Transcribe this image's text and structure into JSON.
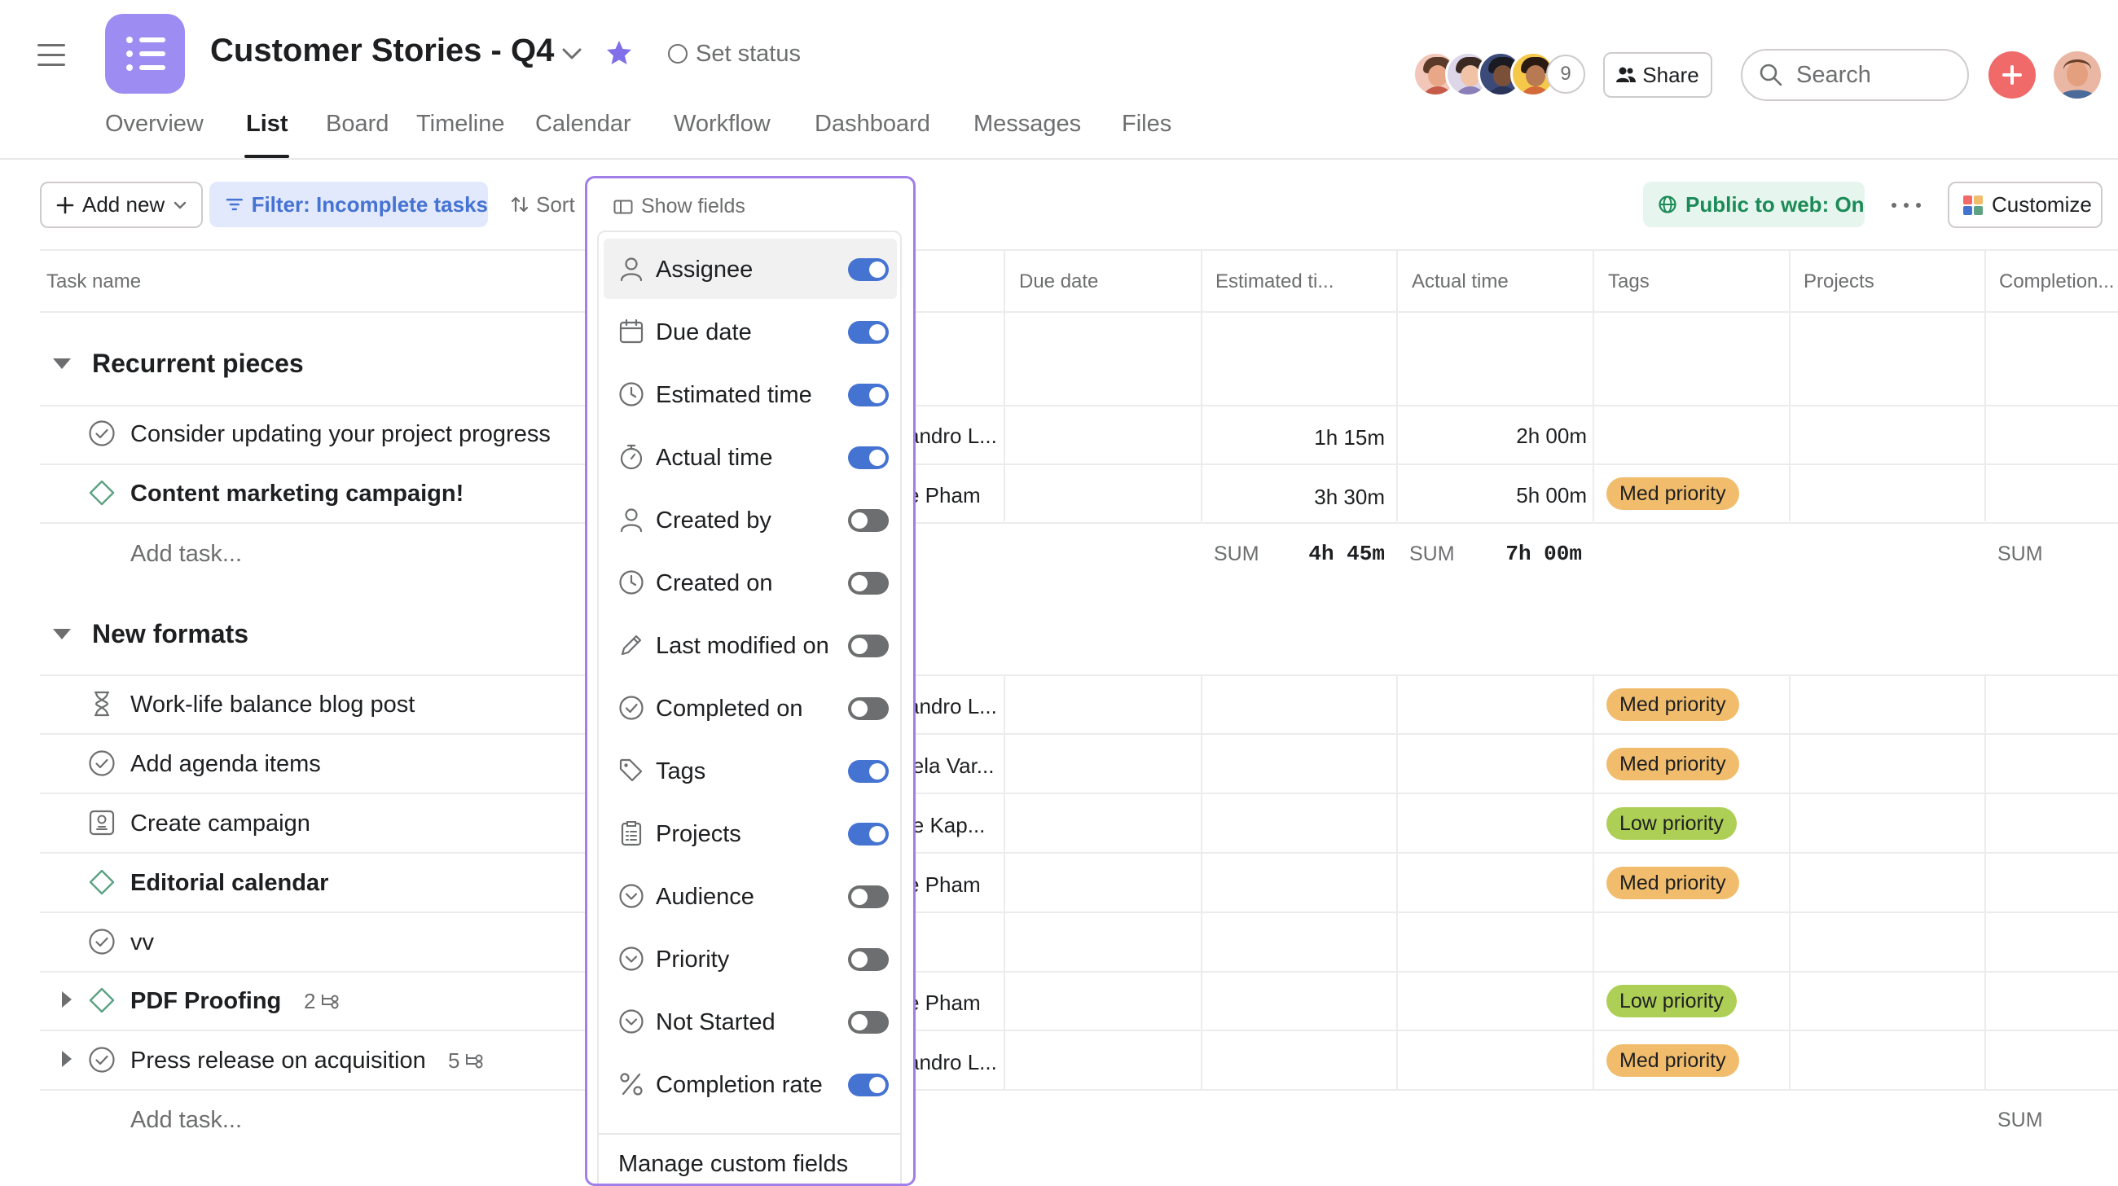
{
  "header": {
    "project_title": "Customer Stories - Q4",
    "set_status": "Set status",
    "avatar_overflow_count": "9",
    "share_label": "Share",
    "search_placeholder": "Search"
  },
  "tabs": [
    "Overview",
    "List",
    "Board",
    "Timeline",
    "Calendar",
    "Workflow",
    "Dashboard",
    "Messages",
    "Files"
  ],
  "active_tab": "List",
  "toolbar": {
    "add_new": "Add new",
    "filter": "Filter: Incomplete tasks",
    "sort": "Sort",
    "show_fields": "Show fields",
    "public_to_web": "Public to web: On",
    "customize": "Customize"
  },
  "columns": {
    "task_name": "Task name",
    "due_date": "Due date",
    "estimated_time": "Estimated ti...",
    "actual_time": "Actual time",
    "tags": "Tags",
    "projects": "Projects",
    "completion": "Completion..."
  },
  "sections": [
    {
      "title": "Recurrent pieces",
      "tasks": [
        {
          "name": "Consider updating your project progress",
          "assignee": "andro L...",
          "estimated": "1h 15m",
          "actual": "2h 00m",
          "tag": ""
        },
        {
          "name": "Content marketing campaign!",
          "assignee": "e Pham",
          "estimated": "3h 30m",
          "actual": "5h 00m",
          "tag": "Med priority"
        }
      ],
      "add_task": "Add task...",
      "sums": {
        "label": "SUM",
        "estimated": "4h 45m",
        "actual": "7h 00m"
      }
    },
    {
      "title": "New formats",
      "tasks": [
        {
          "name": "Work-life balance blog post",
          "assignee": "andro L...",
          "tag": "Med priority"
        },
        {
          "name": "Add agenda items",
          "assignee": "iela Var...",
          "tag": "Med priority"
        },
        {
          "name": "Create campaign",
          "assignee": "ie Kap...",
          "tag": "Low priority"
        },
        {
          "name": "Editorial calendar",
          "assignee": "e Pham",
          "tag": "Med priority"
        },
        {
          "name": "vv",
          "assignee": "",
          "tag": ""
        },
        {
          "name": "PDF Proofing",
          "subtasks": "2",
          "assignee": "e Pham",
          "tag": "Low priority"
        },
        {
          "name": "Press release on acquisition",
          "subtasks": "5",
          "assignee": "andro L...",
          "tag": "Med priority"
        }
      ],
      "add_task": "Add task...",
      "sums": {
        "label": "SUM"
      }
    }
  ],
  "show_fields": {
    "fields": [
      {
        "label": "Assignee",
        "icon": "person-icon",
        "on": true
      },
      {
        "label": "Due date",
        "icon": "calendar-icon",
        "on": true
      },
      {
        "label": "Estimated time",
        "icon": "clock-icon",
        "on": true
      },
      {
        "label": "Actual time",
        "icon": "stopwatch-icon",
        "on": true
      },
      {
        "label": "Created by",
        "icon": "person-icon",
        "on": false
      },
      {
        "label": "Created on",
        "icon": "clock-icon",
        "on": false
      },
      {
        "label": "Last modified on",
        "icon": "pencil-icon",
        "on": false
      },
      {
        "label": "Completed on",
        "icon": "check-circle-icon",
        "on": false
      },
      {
        "label": "Tags",
        "icon": "tag-icon",
        "on": true
      },
      {
        "label": "Projects",
        "icon": "clipboard-icon",
        "on": true
      },
      {
        "label": "Audience",
        "icon": "dropdown-circle-icon",
        "on": false
      },
      {
        "label": "Priority",
        "icon": "dropdown-circle-icon",
        "on": false
      },
      {
        "label": "Not Started",
        "icon": "dropdown-circle-icon",
        "on": false
      },
      {
        "label": "Completion rate",
        "icon": "percent-icon",
        "on": true
      }
    ],
    "manage": "Manage custom fields"
  },
  "colors": {
    "accent": "#4573d2",
    "project_icon": "#9d8cf2",
    "med_priority": "#f1bd6c",
    "low_priority": "#aecf55",
    "dropdown_outline": "#a17ee8",
    "add_button": "#f06a6a"
  }
}
